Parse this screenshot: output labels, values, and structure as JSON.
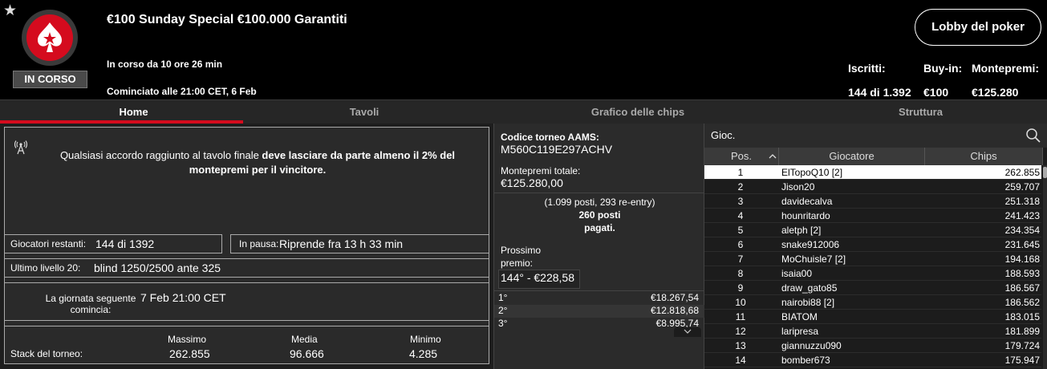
{
  "header": {
    "status_badge": "IN CORSO",
    "title": "€100 Sunday Special €100.000 Garantiti",
    "running": "In corso da 10 ore 26 min",
    "started": "Cominciato alle 21:00 CET, 6 Feb",
    "lobby_button": "Lobby del poker",
    "stats": {
      "registered_label": "Iscritti:",
      "registered_value": "144 di 1.392",
      "buyin_label": "Buy-in:",
      "buyin_value": "€100",
      "prize_label": "Montepremi:",
      "prize_value": "€125.280"
    }
  },
  "tabs": [
    "Home",
    "Tavoli",
    "Grafico delle chips",
    "Struttura"
  ],
  "notice": {
    "text_plain": "Qualsiasi accordo raggiunto al tavolo finale ",
    "text_bold": "deve lasciare da parte almeno il 2% del montepremi per il vincitore."
  },
  "info": {
    "remaining_label": "Giocatori restanti:",
    "remaining_value": "144 di 1392",
    "pause_label": "In pausa:",
    "pause_value": "Riprende fra 13 h 33 min",
    "level_label": "Ultimo livello 20:",
    "level_value": "blind 1250/2500 ante 325",
    "nextday_label": "La giornata seguente comincia:",
    "nextday_value": "7 Feb 21:00 CET",
    "stack_label": "Stack del torneo:",
    "max_label": "Massimo",
    "max_value": "262.855",
    "avg_label": "Media",
    "avg_value": "96.666",
    "min_label": "Minimo",
    "min_value": "4.285"
  },
  "middle": {
    "code_label": "Codice torneo AAMS:",
    "code_value": "M560C119E297ACHV",
    "total_label": "Montepremi totale:",
    "total_value": "€125.280,00",
    "entries": "(1.099 posti, 293 re-entry)",
    "paid_line1": "260 posti",
    "paid_line2": "pagati.",
    "next_prize_label": "Prossimo premio:",
    "next_prize_value": "144° - €228,58",
    "prizes": [
      {
        "place": "1°",
        "amount": "€18.267,54"
      },
      {
        "place": "2°",
        "amount": "€12.818,68"
      },
      {
        "place": "3°",
        "amount": "€8.995,74"
      }
    ]
  },
  "leaderboard": {
    "search_placeholder": "Gioc.",
    "columns": [
      "Pos.",
      "Giocatore",
      "Chips"
    ],
    "rows": [
      {
        "pos": "1",
        "name": "ElTopoQ10 [2]",
        "chips": "262.855"
      },
      {
        "pos": "2",
        "name": "Jison20",
        "chips": "259.707"
      },
      {
        "pos": "3",
        "name": "davidecalva",
        "chips": "251.318"
      },
      {
        "pos": "4",
        "name": "hounritardo",
        "chips": "241.423"
      },
      {
        "pos": "5",
        "name": "aletph [2]",
        "chips": "234.354"
      },
      {
        "pos": "6",
        "name": "snake912006",
        "chips": "231.645"
      },
      {
        "pos": "7",
        "name": "MoChuisle7 [2]",
        "chips": "194.168"
      },
      {
        "pos": "8",
        "name": "isaia00",
        "chips": "188.593"
      },
      {
        "pos": "9",
        "name": "draw_gato85",
        "chips": "186.567"
      },
      {
        "pos": "10",
        "name": "nairobi88 [2]",
        "chips": "186.562"
      },
      {
        "pos": "11",
        "name": "BIATOM",
        "chips": "183.015"
      },
      {
        "pos": "12",
        "name": "laripresa",
        "chips": "181.899"
      },
      {
        "pos": "13",
        "name": "giannuzzu090",
        "chips": "179.724"
      },
      {
        "pos": "14",
        "name": "bomber673",
        "chips": "175.947"
      }
    ]
  }
}
